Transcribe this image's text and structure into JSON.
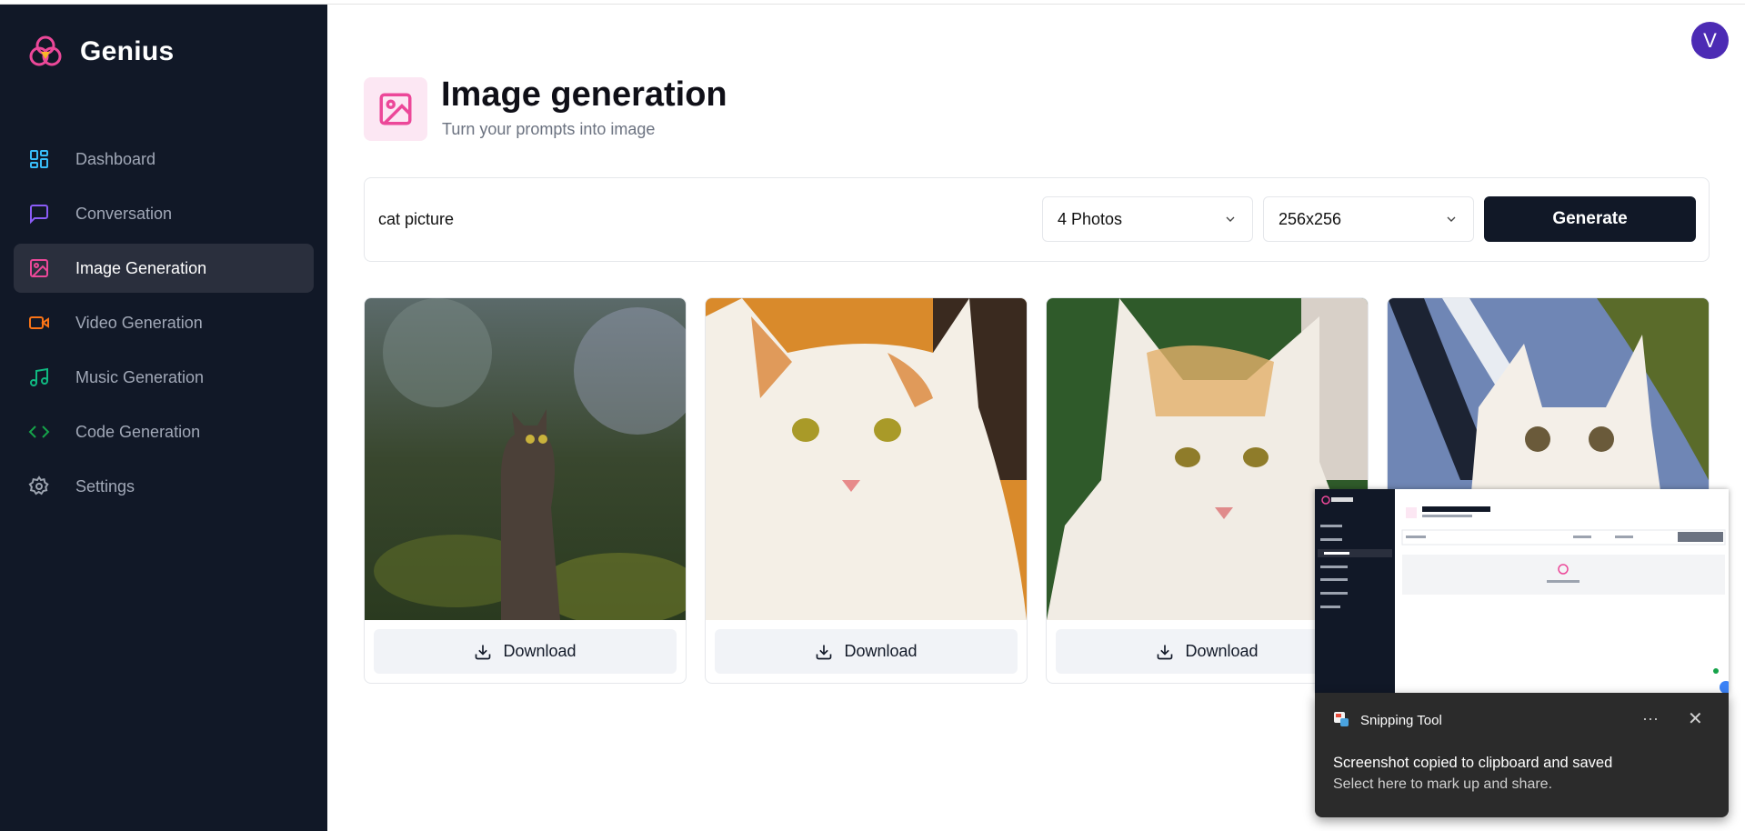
{
  "app": {
    "name": "Genius"
  },
  "sidebar": {
    "items": [
      {
        "label": "Dashboard",
        "icon": "dashboard-icon",
        "color": "#38bdf8"
      },
      {
        "label": "Conversation",
        "icon": "message-square-icon",
        "color": "#8b5cf6"
      },
      {
        "label": "Image Generation",
        "icon": "image-icon",
        "color": "#ec4899",
        "active": true
      },
      {
        "label": "Video Generation",
        "icon": "video-icon",
        "color": "#f97316"
      },
      {
        "label": "Music Generation",
        "icon": "music-icon",
        "color": "#10b981"
      },
      {
        "label": "Code Generation",
        "icon": "code-icon",
        "color": "#16a34a"
      },
      {
        "label": "Settings",
        "icon": "settings-icon",
        "color": "#9ca3af"
      }
    ]
  },
  "header": {
    "title": "Image generation",
    "subtitle": "Turn your prompts into image",
    "icon": "image-icon",
    "icon_color": "#ec4899",
    "icon_bg": "#fce7f3"
  },
  "user": {
    "avatar_initial": "V",
    "avatar_color": "#4c2bb4"
  },
  "form": {
    "prompt_value": "cat picture",
    "amount_selected": "4 Photos",
    "resolution_selected": "256x256",
    "generate_label": "Generate"
  },
  "results": {
    "download_label": "Download",
    "images": [
      "cat-photo-1",
      "cat-photo-2",
      "cat-photo-3",
      "cat-photo-4"
    ]
  },
  "snipping_tool": {
    "app_name": "Snipping Tool",
    "message": "Screenshot copied to clipboard and saved",
    "sub_message": "Select here to mark up and share.",
    "more_label": "···",
    "close_label": "✕"
  }
}
